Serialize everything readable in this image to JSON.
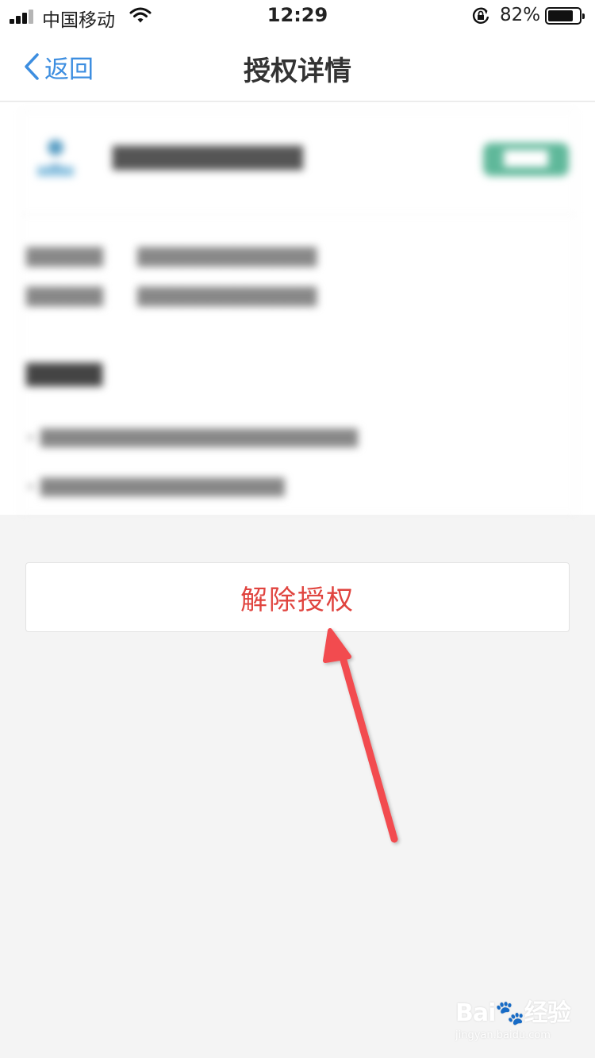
{
  "status_bar": {
    "carrier": "中国移动",
    "time": "12:29",
    "battery_percent_label": "82%",
    "battery_level": 0.82
  },
  "nav": {
    "back_label": "返回",
    "title": "授权详情"
  },
  "action": {
    "revoke_label": "解除授权"
  },
  "colors": {
    "accent": "#3d8ee0",
    "danger": "#e0443f",
    "background": "#f4f4f4",
    "arrow": "#f24c4f"
  },
  "watermark": {
    "brand": "Bai",
    "brand_suffix": "经验",
    "url": "jingyan.baidu.com"
  }
}
